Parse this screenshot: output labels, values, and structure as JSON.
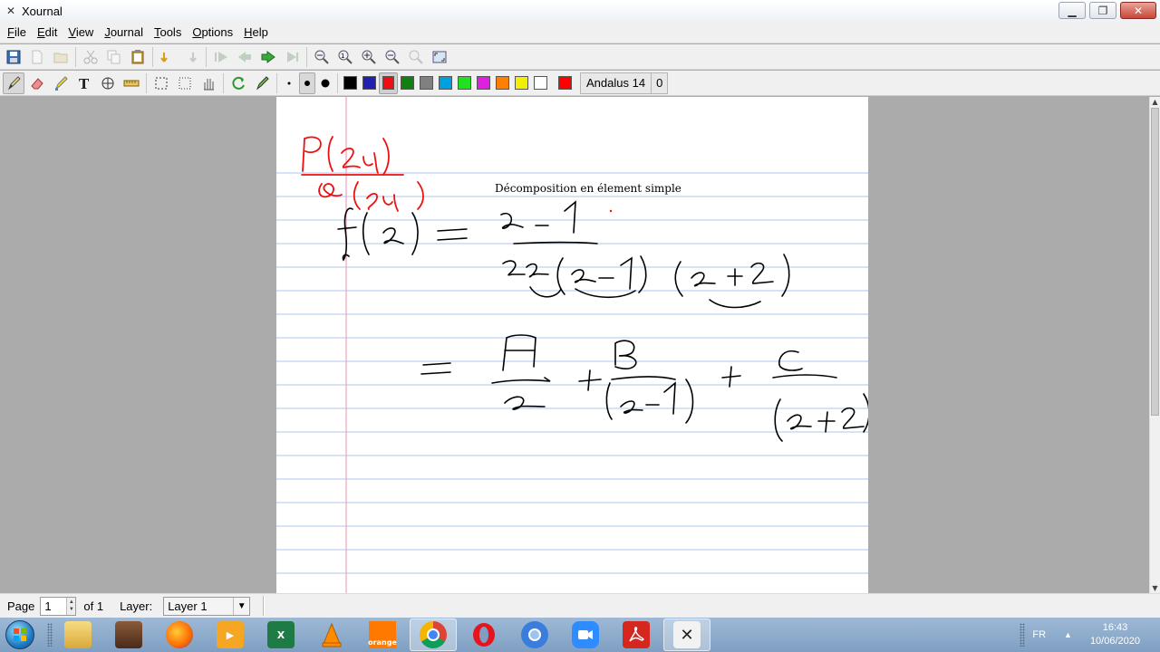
{
  "window": {
    "title": "Xournal",
    "icon": "xournal-x-icon"
  },
  "menubar": [
    "File",
    "Edit",
    "View",
    "Journal",
    "Tools",
    "Options",
    "Help"
  ],
  "font_button": {
    "name": "Andalus 14",
    "extra": "0"
  },
  "colors": [
    "#000000",
    "#2020b0",
    "#ee1010",
    "#108010",
    "#808080",
    "#00a0e0",
    "#20e020",
    "#e020e0",
    "#ff8000",
    "#f0f000",
    "#ffffff",
    "#ff0000"
  ],
  "page_content": {
    "typed_text": "Décomposition en élement simple"
  },
  "statusbar": {
    "page_label": "Page",
    "page_value": "1",
    "of_label": "of 1",
    "layer_label": "Layer:",
    "layer_value": "Layer 1"
  },
  "taskbar": {
    "apps": [
      "windows-explorer",
      "user-avatar",
      "firefox",
      "media-player",
      "excel",
      "vlc",
      "orange",
      "chrome",
      "opera",
      "chrome-canary",
      "zoom",
      "acrobat-reader",
      "xournal"
    ],
    "orange_label": "orange",
    "lang": "FR",
    "time": "16:43",
    "date": "10/06/2020"
  }
}
